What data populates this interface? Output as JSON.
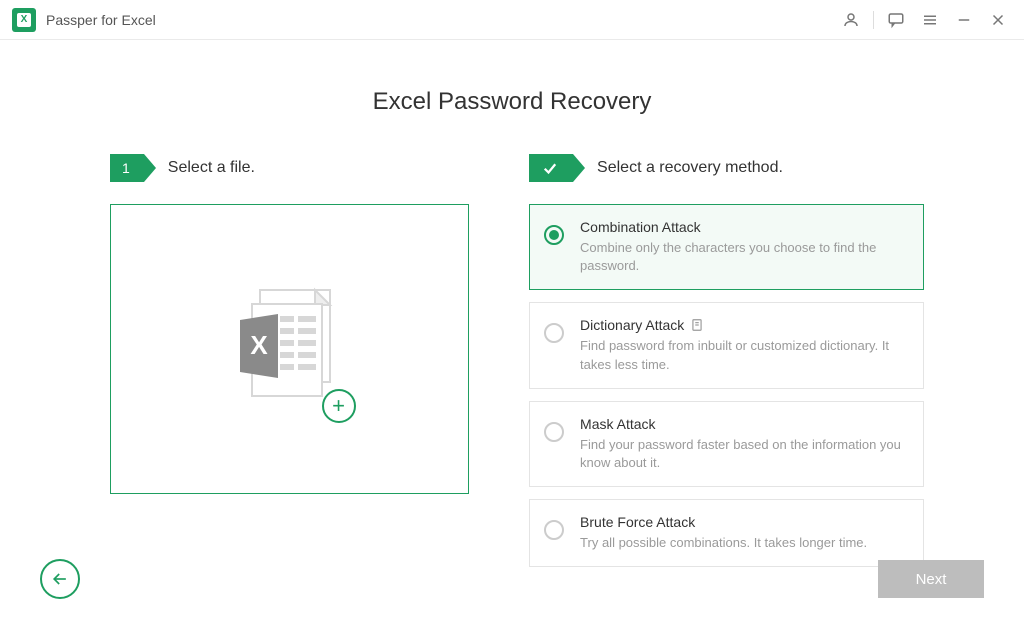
{
  "app": {
    "title": "Passper for Excel"
  },
  "page": {
    "title": "Excel Password Recovery"
  },
  "steps": {
    "one": {
      "badge": "1",
      "label": "Select a file."
    },
    "two": {
      "label": "Select a recovery method."
    }
  },
  "methods": [
    {
      "title": "Combination Attack",
      "desc": "Combine only the characters you choose to find the password.",
      "selected": true
    },
    {
      "title": "Dictionary Attack",
      "desc": "Find password from inbuilt or customized dictionary. It takes less time.",
      "selected": false,
      "hasIcon": true
    },
    {
      "title": "Mask Attack",
      "desc": "Find your password faster based on the information you know about it.",
      "selected": false
    },
    {
      "title": "Brute Force Attack",
      "desc": "Try all possible combinations. It takes longer time.",
      "selected": false
    }
  ],
  "footer": {
    "next": "Next"
  }
}
